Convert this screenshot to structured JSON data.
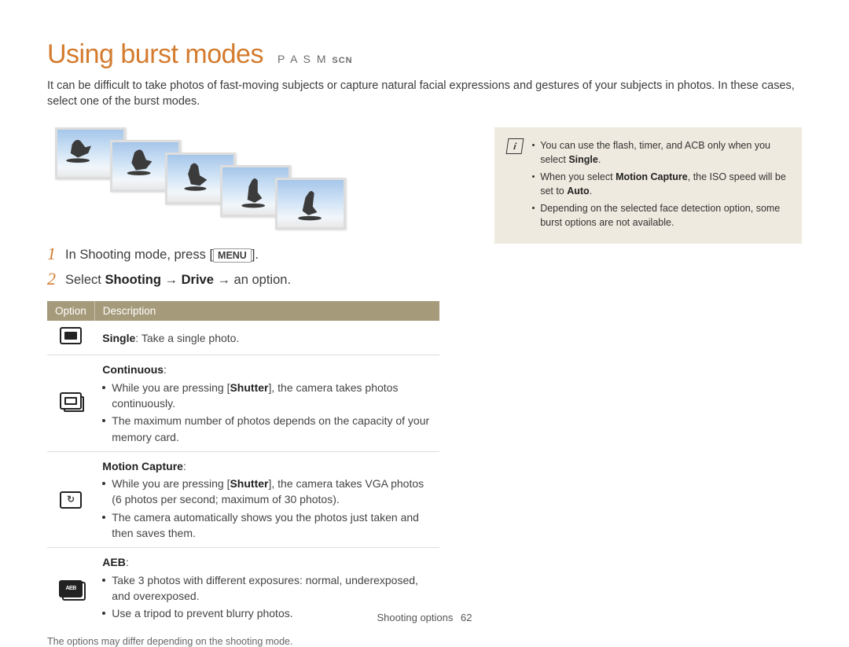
{
  "title": "Using burst modes",
  "modeLetters": "P A S M",
  "modeScn": "SCN",
  "intro": "It can be difficult to take photos of fast-moving subjects or capture natural facial expressions and gestures of your subjects in photos. In these cases, select one of the burst modes.",
  "step1_pre": "In Shooting mode, press [",
  "step1_key": "MENU",
  "step1_post": "].",
  "step2_a": "Select ",
  "step2_b": "Shooting",
  "step2_c": " → ",
  "step2_d": "Drive",
  "step2_e": " → an option.",
  "tbl": {
    "h1": "Option",
    "h2": "Description",
    "single_b": "Single",
    "single_t": ": Take a single photo.",
    "cont_b": "Continuous",
    "cont_colon": ":",
    "cont_l1a": "While you are pressing [",
    "cont_l1key": "Shutter",
    "cont_l1b": "], the camera takes photos continuously.",
    "cont_l2": "The maximum number of photos depends on the capacity of your memory card.",
    "mc_b": "Motion Capture",
    "mc_colon": ":",
    "mc_l1a": "While you are pressing [",
    "mc_l1key": "Shutter",
    "mc_l1b": "], the camera takes VGA photos (6 photos per second; maximum of 30 photos).",
    "mc_l2": "The camera automatically shows you the photos just taken and then saves them.",
    "aeb_b": "AEB",
    "aeb_colon": ":",
    "aeb_l1": "Take 3 photos with different exposures: normal, underexposed, and overexposed.",
    "aeb_l2": "Use a tripod to prevent blurry photos."
  },
  "note": "The options may differ depending on the shooting mode.",
  "info": {
    "l1a": "You can use the flash, timer, and ACB only when you select ",
    "l1b": "Single",
    "l1c": ".",
    "l2a": "When you select ",
    "l2b": "Motion Capture",
    "l2c": ", the ISO speed will be set to ",
    "l2d": "Auto",
    "l2e": ".",
    "l3": "Depending on the selected face detection option, some burst options are not available."
  },
  "footer_section": "Shooting options",
  "footer_page": "62"
}
